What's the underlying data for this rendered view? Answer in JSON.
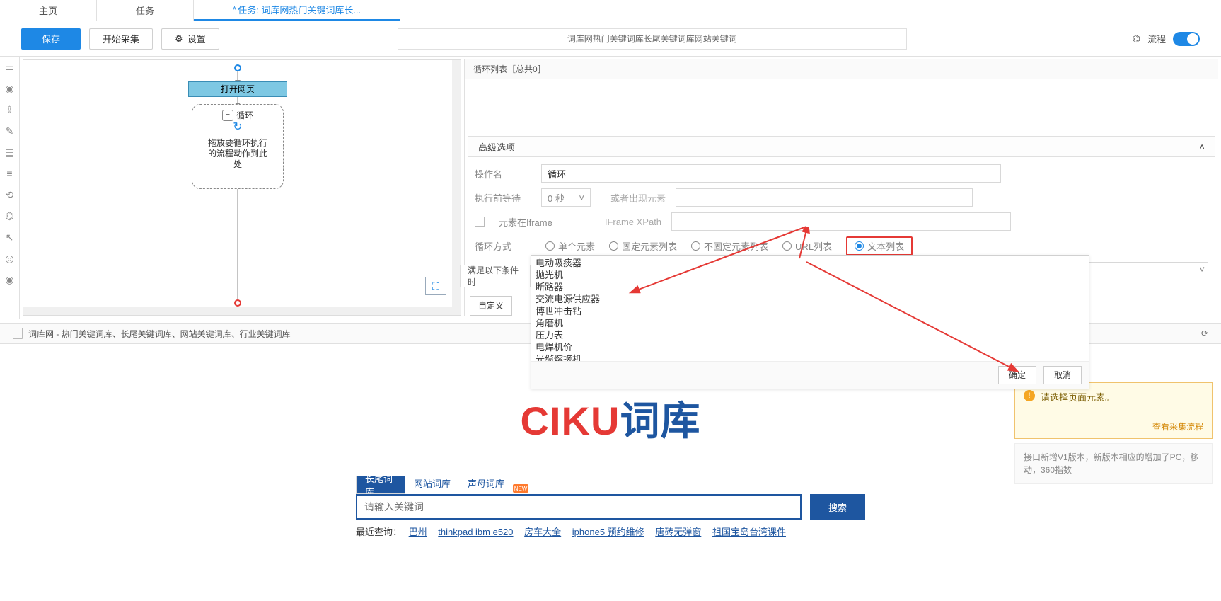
{
  "tabs": {
    "t0": "主页",
    "t1": "任务",
    "t2_prefix": "*",
    "t2": "任务: 词库网热门关键词库长..."
  },
  "toolbar": {
    "save": "保存",
    "start": "开始采集",
    "settings": "设置",
    "title": "词库网热门关键词库长尾关键词库网站关键词",
    "flow": "流程"
  },
  "canvas": {
    "open": "打开网页",
    "loop": "循环",
    "drop": "拖放要循环执行\n的流程动作到此\n处"
  },
  "right": {
    "head": "循环列表［总共0］",
    "adv": "高级选项",
    "opname_l": "操作名",
    "opname_v": "循环",
    "wait_l": "执行前等待",
    "wait_v": "0 秒",
    "wait_or_l": "或者出现元素",
    "iframe_l": "元素在Iframe",
    "iframe_xpath_l": "IFrame XPath",
    "mode_l": "循环方式",
    "modes": {
      "single": "单个元素",
      "fixed": "固定元素列表",
      "varlist": "不固定元素列表",
      "urllist": "URL列表",
      "textlist": "文本列表"
    },
    "textlist_l": "文本列表",
    "cond": "满足以下条件时",
    "custom": "自定义",
    "ok": "确定",
    "cancel": "取消",
    "textarea": "电动吸痰器\n抛光机\n断路器\n交流电源供应器\n博世冲击钻\n角磨机\n压力表\n电焊机价\n光缆熔接机"
  },
  "pagetitle": "词库网 - 热门关键词库、长尾关键词库、网站关键词库、行业关键词库",
  "site": {
    "tabs": {
      "t0": "长尾词库",
      "t1": "网站词库",
      "t2": "声母词库",
      "new": "NEW"
    },
    "placeholder": "请输入关键词",
    "search": "搜索",
    "recent_l": "最近查询：",
    "recent": [
      "巴州",
      "thinkpad ibm e520",
      "房车大全",
      "iphone5 预约维修",
      "唐砖无弹窗",
      "祖国宝岛台湾课件"
    ]
  },
  "tip": {
    "text": "请选择页面元素。",
    "link": "查看采集流程"
  },
  "ver": "接口新增V1版本，新版本相应的增加了PC，移动，360指数"
}
